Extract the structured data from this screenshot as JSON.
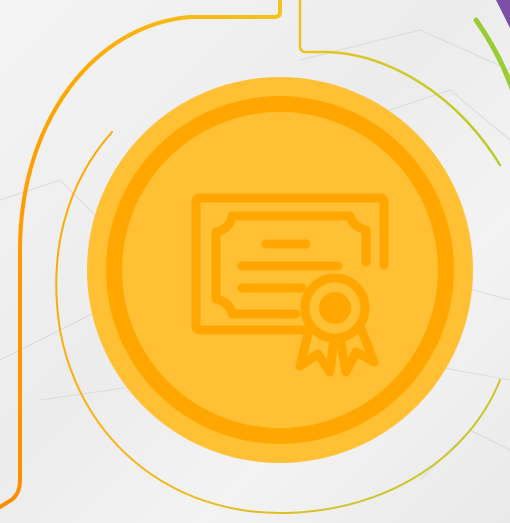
{
  "graphic": {
    "icon": "certificate-icon",
    "colors": {
      "background": "#f1f1f1",
      "background_texture": "#dedede",
      "medallion_outer": "#ffa600",
      "medallion_inner": "#ffc133",
      "icon": "#ffa600",
      "arc_orange": "#ff9100",
      "arc_yellow": "#f7c51c",
      "arc_green": "#9acd32",
      "arc_purple": "#7b4fa8"
    }
  }
}
